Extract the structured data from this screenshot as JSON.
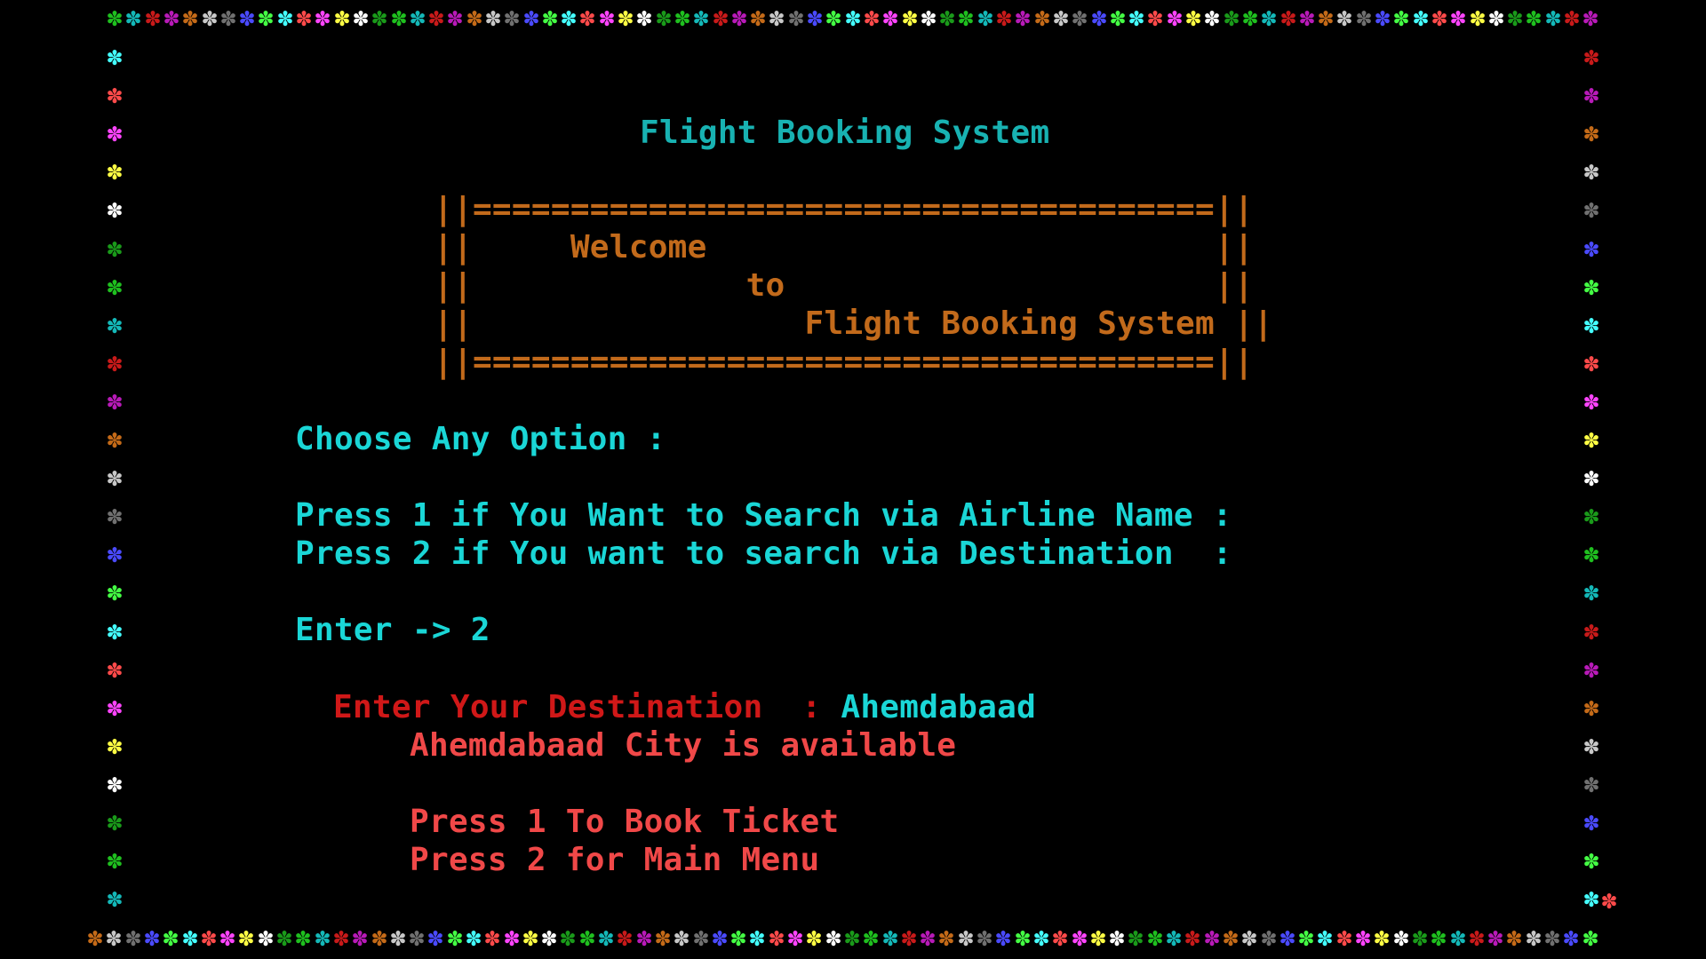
{
  "screen": {
    "title": "Flight Booking System",
    "welcome_box": {
      "top_border": "||======================================||",
      "line1": "||     Welcome                          ||",
      "line2": "||              to                      ||",
      "line3": "||                 Flight Booking System ||",
      "bottom_border": "||======================================||"
    },
    "menu": {
      "prompt": "Choose Any Option :",
      "option1": "Press 1 if You Want to Search via Airline Name :",
      "option2": "Press 2 if You want to search via Destination  :",
      "entry": "Enter -> 2"
    },
    "destination": {
      "label": "Enter Your Destination  :",
      "value": "Ahemdabaad",
      "status": "Ahemdabaad City is available"
    },
    "actions": {
      "book": "Press 1 To Book Ticket",
      "main_menu": "Press 2 for Main Menu"
    }
  },
  "border": {
    "glyph": "✽",
    "palette": [
      "#1fbf1f",
      "#14b8b8",
      "#c81a1a",
      "#b81ab8",
      "#c46a18",
      "#c8c8c8",
      "#707070",
      "#4a4aff",
      "#44ff44",
      "#44ffff",
      "#ff4a4a",
      "#ff44ff",
      "#ffff44",
      "#ffffff",
      "#1a9a1a"
    ]
  },
  "colors": {
    "background": "#000000",
    "title": "#18b2b2",
    "menu_text": "#1ad6d6",
    "box_text": "#c26a1b",
    "destination_label": "#d01818",
    "destination_value": "#1ad6d6",
    "available_text": "#f04848"
  }
}
